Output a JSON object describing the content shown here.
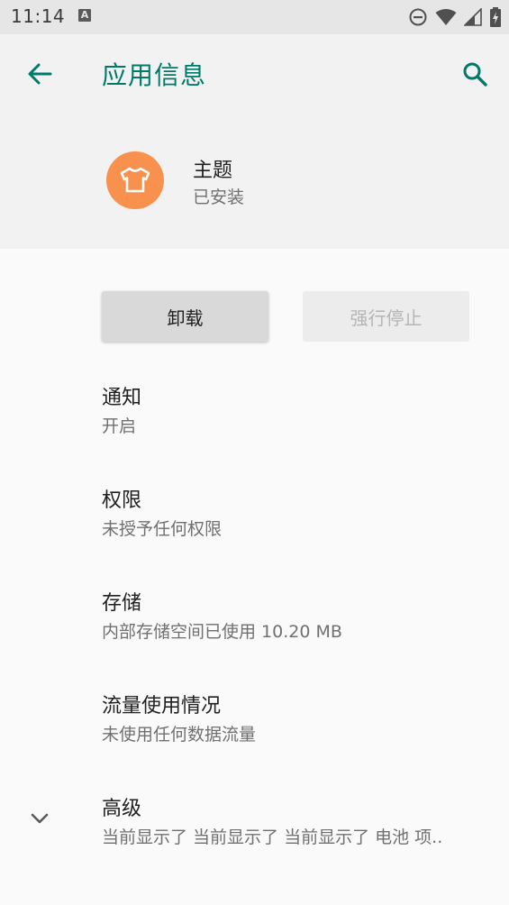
{
  "status_bar": {
    "time": "11:14",
    "notification_letter": "A"
  },
  "header": {
    "title": "应用信息"
  },
  "app": {
    "name": "主题",
    "status": "已安装",
    "icon": "t-shirt-icon",
    "icon_color": "#f8914d"
  },
  "actions": {
    "uninstall_label": "卸载",
    "force_stop_label": "强行停止"
  },
  "prefs": {
    "notifications": {
      "title": "通知",
      "summary": "开启"
    },
    "permissions": {
      "title": "权限",
      "summary": "未授予任何权限"
    },
    "storage": {
      "title": "存储",
      "summary": "内部存储空间已使用 10.20 MB"
    },
    "data_usage": {
      "title": "流量使用情况",
      "summary": "未使用任何数据流量"
    },
    "advanced": {
      "title": "高级",
      "summary": "当前显示了 当前显示了 当前显示了 电池 项.."
    }
  },
  "colors": {
    "accent": "#00796b",
    "app_bar_bg": "#f2f2f2",
    "status_bar_bg": "#e6e6e6"
  }
}
